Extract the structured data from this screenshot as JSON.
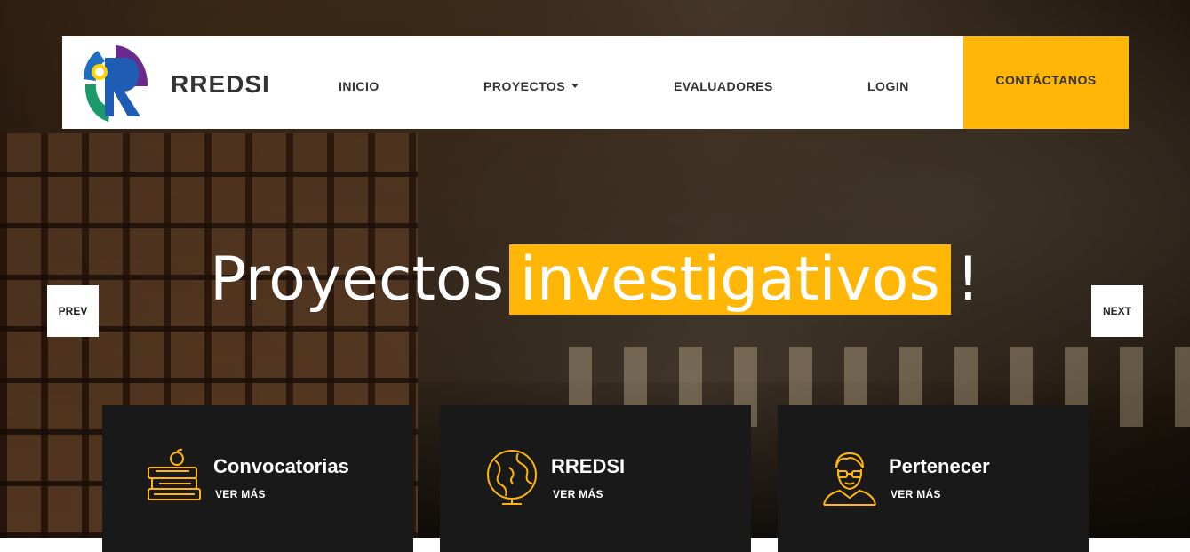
{
  "brand": {
    "name": "RREDSI"
  },
  "nav": {
    "items": [
      {
        "label": "INICIO"
      },
      {
        "label": "PROYECTOS"
      },
      {
        "label": "EVALUADORES"
      },
      {
        "label": "LOGIN"
      }
    ],
    "contact_label": "CONTÁCTANOS"
  },
  "hero": {
    "headline_part1": "Proyectos",
    "headline_highlight": "investigativos",
    "headline_end": "!",
    "prev_label": "PREV",
    "next_label": "NEXT"
  },
  "features": [
    {
      "title": "Convocatorias",
      "link": "VER MÁS",
      "icon": "books-apple-icon"
    },
    {
      "title": "RREDSI",
      "link": "VER MÁS",
      "icon": "globe-icon"
    },
    {
      "title": "Pertenecer",
      "link": "VER MÁS",
      "icon": "person-glasses-icon"
    }
  ],
  "colors": {
    "accent": "#ffb606",
    "card_bg": "#191919",
    "text_dark": "#333333"
  }
}
